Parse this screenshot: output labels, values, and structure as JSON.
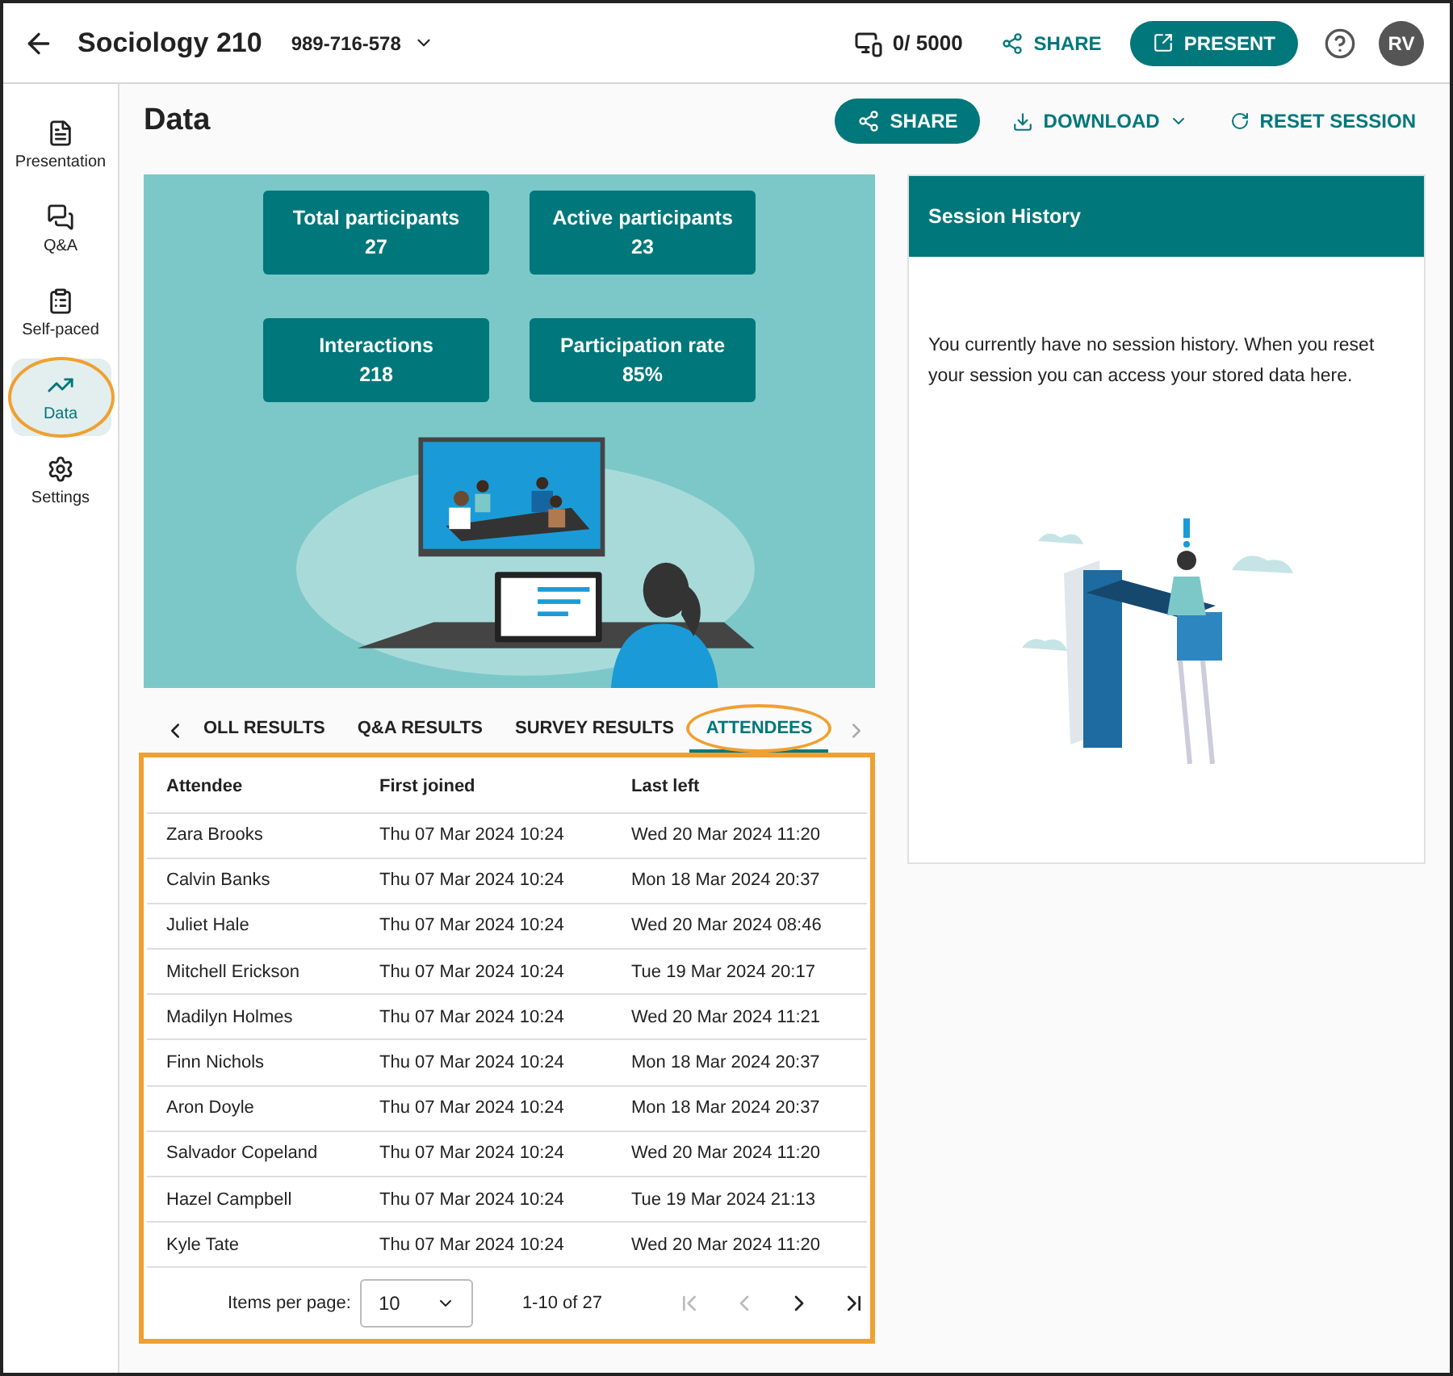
{
  "top_bar": {
    "title": "Sociology 210",
    "session_code": "989-716-578",
    "device_count": "0/ 5000",
    "share": "SHARE",
    "present": "PRESENT",
    "avatar": "RV"
  },
  "sidebar": {
    "items": [
      {
        "label": "Presentation",
        "selected": false,
        "callout": false
      },
      {
        "label": "Q&A",
        "selected": false,
        "callout": false
      },
      {
        "label": "Self-paced",
        "selected": false,
        "callout": false
      },
      {
        "label": "Data",
        "selected": true,
        "callout": true
      },
      {
        "label": "Settings",
        "selected": false,
        "callout": false
      }
    ]
  },
  "page": {
    "title": "Data",
    "actions": [
      {
        "kind": "primary",
        "label": "SHARE"
      },
      {
        "kind": "dropdown",
        "label": "DOWNLOAD"
      },
      {
        "kind": "reset",
        "label": "RESET SESSION"
      }
    ]
  },
  "stats": [
    {
      "label": "Total participants",
      "value": "27"
    },
    {
      "label": "Active participants",
      "value": "23"
    },
    {
      "label": "Interactions",
      "value": "218"
    },
    {
      "label": "Participation rate",
      "value": "85%"
    }
  ],
  "session_history": {
    "title": "Session History",
    "message": "You currently have no session history. When you reset your session you can access your stored data here."
  },
  "tabs": [
    {
      "label": "OLL RESULTS",
      "selected": false,
      "callout": false
    },
    {
      "label": "Q&A RESULTS",
      "selected": false,
      "callout": false
    },
    {
      "label": "SURVEY RESULTS",
      "selected": false,
      "callout": false
    },
    {
      "label": "ATTENDEES",
      "selected": true,
      "callout": true
    }
  ],
  "table": {
    "callout": true,
    "columns": [
      "Attendee",
      "First joined",
      "Last left"
    ],
    "rows": [
      [
        "Zara Brooks",
        "Thu 07 Mar 2024 10:24",
        "Wed 20 Mar 2024 11:20"
      ],
      [
        "Calvin Banks",
        "Thu 07 Mar 2024 10:24",
        "Mon 18 Mar 2024 20:37"
      ],
      [
        "Juliet Hale",
        "Thu 07 Mar 2024 10:24",
        "Wed 20 Mar 2024 08:46"
      ],
      [
        "Mitchell Erickson",
        "Thu 07 Mar 2024 10:24",
        "Tue 19 Mar 2024 20:17"
      ],
      [
        "Madilyn Holmes",
        "Thu 07 Mar 2024 10:24",
        "Wed 20 Mar 2024 11:21"
      ],
      [
        "Finn Nichols",
        "Thu 07 Mar 2024 10:24",
        "Mon 18 Mar 2024 20:37"
      ],
      [
        "Aron Doyle",
        "Thu 07 Mar 2024 10:24",
        "Mon 18 Mar 2024 20:37"
      ],
      [
        "Salvador Copeland",
        "Thu 07 Mar 2024 10:24",
        "Wed 20 Mar 2024 11:20"
      ],
      [
        "Hazel Campbell",
        "Thu 07 Mar 2024 10:24",
        "Tue 19 Mar 2024 21:13"
      ],
      [
        "Kyle Tate",
        "Thu 07 Mar 2024 10:24",
        "Wed 20 Mar 2024 11:20"
      ]
    ]
  },
  "pagination": {
    "label": "Items per page:",
    "page_size": "10",
    "range": "1-10 of 27",
    "nav_buttons": [
      {
        "disabled": true
      },
      {
        "disabled": true
      },
      {
        "disabled": false
      },
      {
        "disabled": false
      }
    ]
  }
}
